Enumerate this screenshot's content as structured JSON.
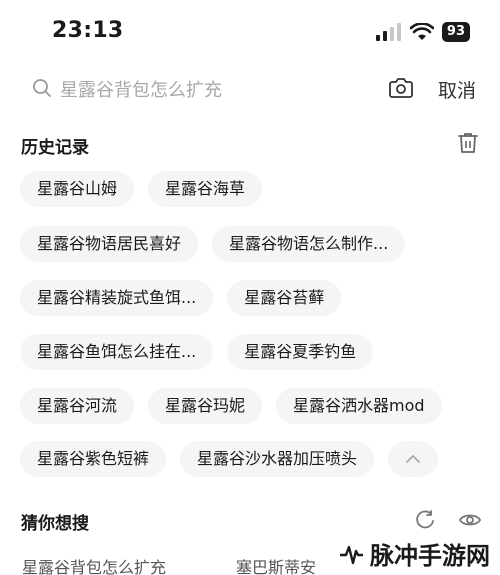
{
  "status_bar": {
    "time": "23:13",
    "battery": "93"
  },
  "search": {
    "placeholder": "星露谷背包怎么扩充",
    "cancel_label": "取消"
  },
  "history": {
    "title": "历史记录",
    "rows": [
      [
        "星露谷山姆",
        "星露谷海草"
      ],
      [
        "星露谷物语居民喜好",
        "星露谷物语怎么制作..."
      ],
      [
        "星露谷精装旋式鱼饵...",
        "星露谷苔藓"
      ],
      [
        "星露谷鱼饵怎么挂在...",
        "星露谷夏季钓鱼"
      ],
      [
        "星露谷河流",
        "星露谷玛妮",
        "星露谷洒水器mod"
      ],
      [
        "星露谷紫色短裤",
        "星露谷沙水器加压喷头"
      ]
    ]
  },
  "guess": {
    "title": "猜你想搜",
    "items": [
      "星露谷背包怎么扩充",
      "塞巴斯蒂安"
    ]
  },
  "watermark": {
    "text": "脉冲手游网"
  },
  "icons": [
    "search-icon",
    "camera-icon",
    "trash-icon",
    "chevron-up-icon",
    "refresh-icon",
    "eye-icon",
    "wifi-icon",
    "signal-icon"
  ]
}
